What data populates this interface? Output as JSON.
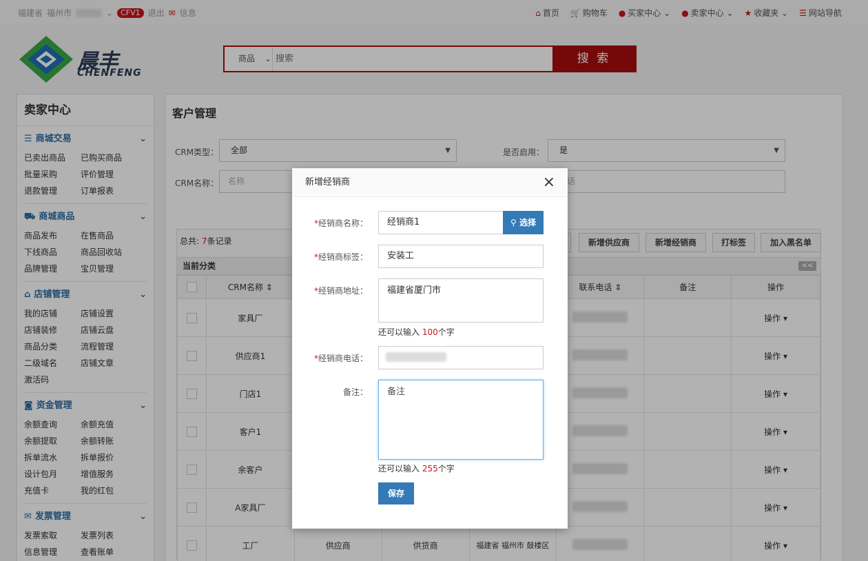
{
  "topbar": {
    "province": "福建省",
    "city": "福州市",
    "badge": "CFV1",
    "logout": "退出",
    "messages": "信息",
    "links": [
      "首页",
      "购物车",
      "买家中心",
      "卖家中心",
      "收藏夹",
      "网站导航"
    ]
  },
  "logo": {
    "cn": "晨丰",
    "en": "CHENFENG"
  },
  "search": {
    "category": "商品",
    "placeholder": "搜索",
    "button": "搜 索"
  },
  "sidebar": {
    "title": "卖家中心",
    "groups": [
      {
        "title": "商城交易",
        "icon": "list-icon",
        "items": [
          "已卖出商品",
          "已购买商品",
          "批量采购",
          "评价管理",
          "退款管理",
          "订单报表"
        ]
      },
      {
        "title": "商城商品",
        "icon": "truck-icon",
        "items": [
          "商品发布",
          "在售商品",
          "下线商品",
          "商品回收站",
          "品牌管理",
          "宝贝管理"
        ]
      },
      {
        "title": "店铺管理",
        "icon": "home-icon",
        "items": [
          "我的店铺",
          "店铺设置",
          "店铺装修",
          "店铺云盘",
          "商品分类",
          "流程管理",
          "二级域名",
          "店铺文章",
          "激活码"
        ]
      },
      {
        "title": "资金管理",
        "icon": "money-icon",
        "items": [
          "余额查询",
          "余额充值",
          "余额提取",
          "余额转账",
          "拆单流水",
          "拆单报价",
          "设计包月",
          "增值服务",
          "充值卡",
          "我的红包"
        ]
      },
      {
        "title": "发票管理",
        "icon": "mail-icon",
        "items": [
          "发票索取",
          "发票列表",
          "信息管理",
          "查看账单"
        ]
      }
    ]
  },
  "main": {
    "title": "客户管理",
    "filters": {
      "crm_type_label": "CRM类型：",
      "crm_type_value": "全部",
      "enabled_label": "是否启用：",
      "enabled_value": "是",
      "crm_name_label": "CRM名称：",
      "crm_name_placeholder": "名称",
      "phone_placeholder": "话"
    },
    "total_prefix": "总共:",
    "total_count": "7",
    "total_suffix": "条记录",
    "buttons": [
      "新增供应商",
      "新增经销商",
      "打标签",
      "加入黑名单"
    ],
    "current_category": "当前分类",
    "collapse": "<<",
    "columns": {
      "name": "CRM名称",
      "phone": "联系电话",
      "remark": "备注",
      "action": "操作"
    },
    "rows": [
      {
        "name": "家具厂",
        "action": "操作"
      },
      {
        "name": "供应商1",
        "action": "操作"
      },
      {
        "name": "门店1",
        "action": "操作"
      },
      {
        "name": "客户1",
        "action": "操作"
      },
      {
        "name": "余客户",
        "action": "操作"
      },
      {
        "name": "A家具厂",
        "action": "操作"
      },
      {
        "name": "工厂",
        "type": "供应商",
        "type2": "供货商",
        "address": "福建省 福州市 鼓楼区",
        "action": "操作"
      }
    ]
  },
  "modal": {
    "title": "新增经销商",
    "close": "×",
    "name_label": "经销商名称：",
    "name_value": "经销商1",
    "pick_button": "选择",
    "tag_label": "经销商标签：",
    "tag_value": "安装工",
    "address_label": "经销商地址：",
    "address_value": "福建省厦门市",
    "address_hint_prefix": "还可以输入",
    "address_hint_count": "100",
    "address_hint_suffix": "个字",
    "phone_label": "经销商电话：",
    "remark_label": "备注：",
    "remark_placeholder": "备注",
    "remark_hint_prefix": "还可以输入",
    "remark_hint_count": "255",
    "remark_hint_suffix": "个字",
    "save": "保存",
    "required_mark": "*"
  }
}
